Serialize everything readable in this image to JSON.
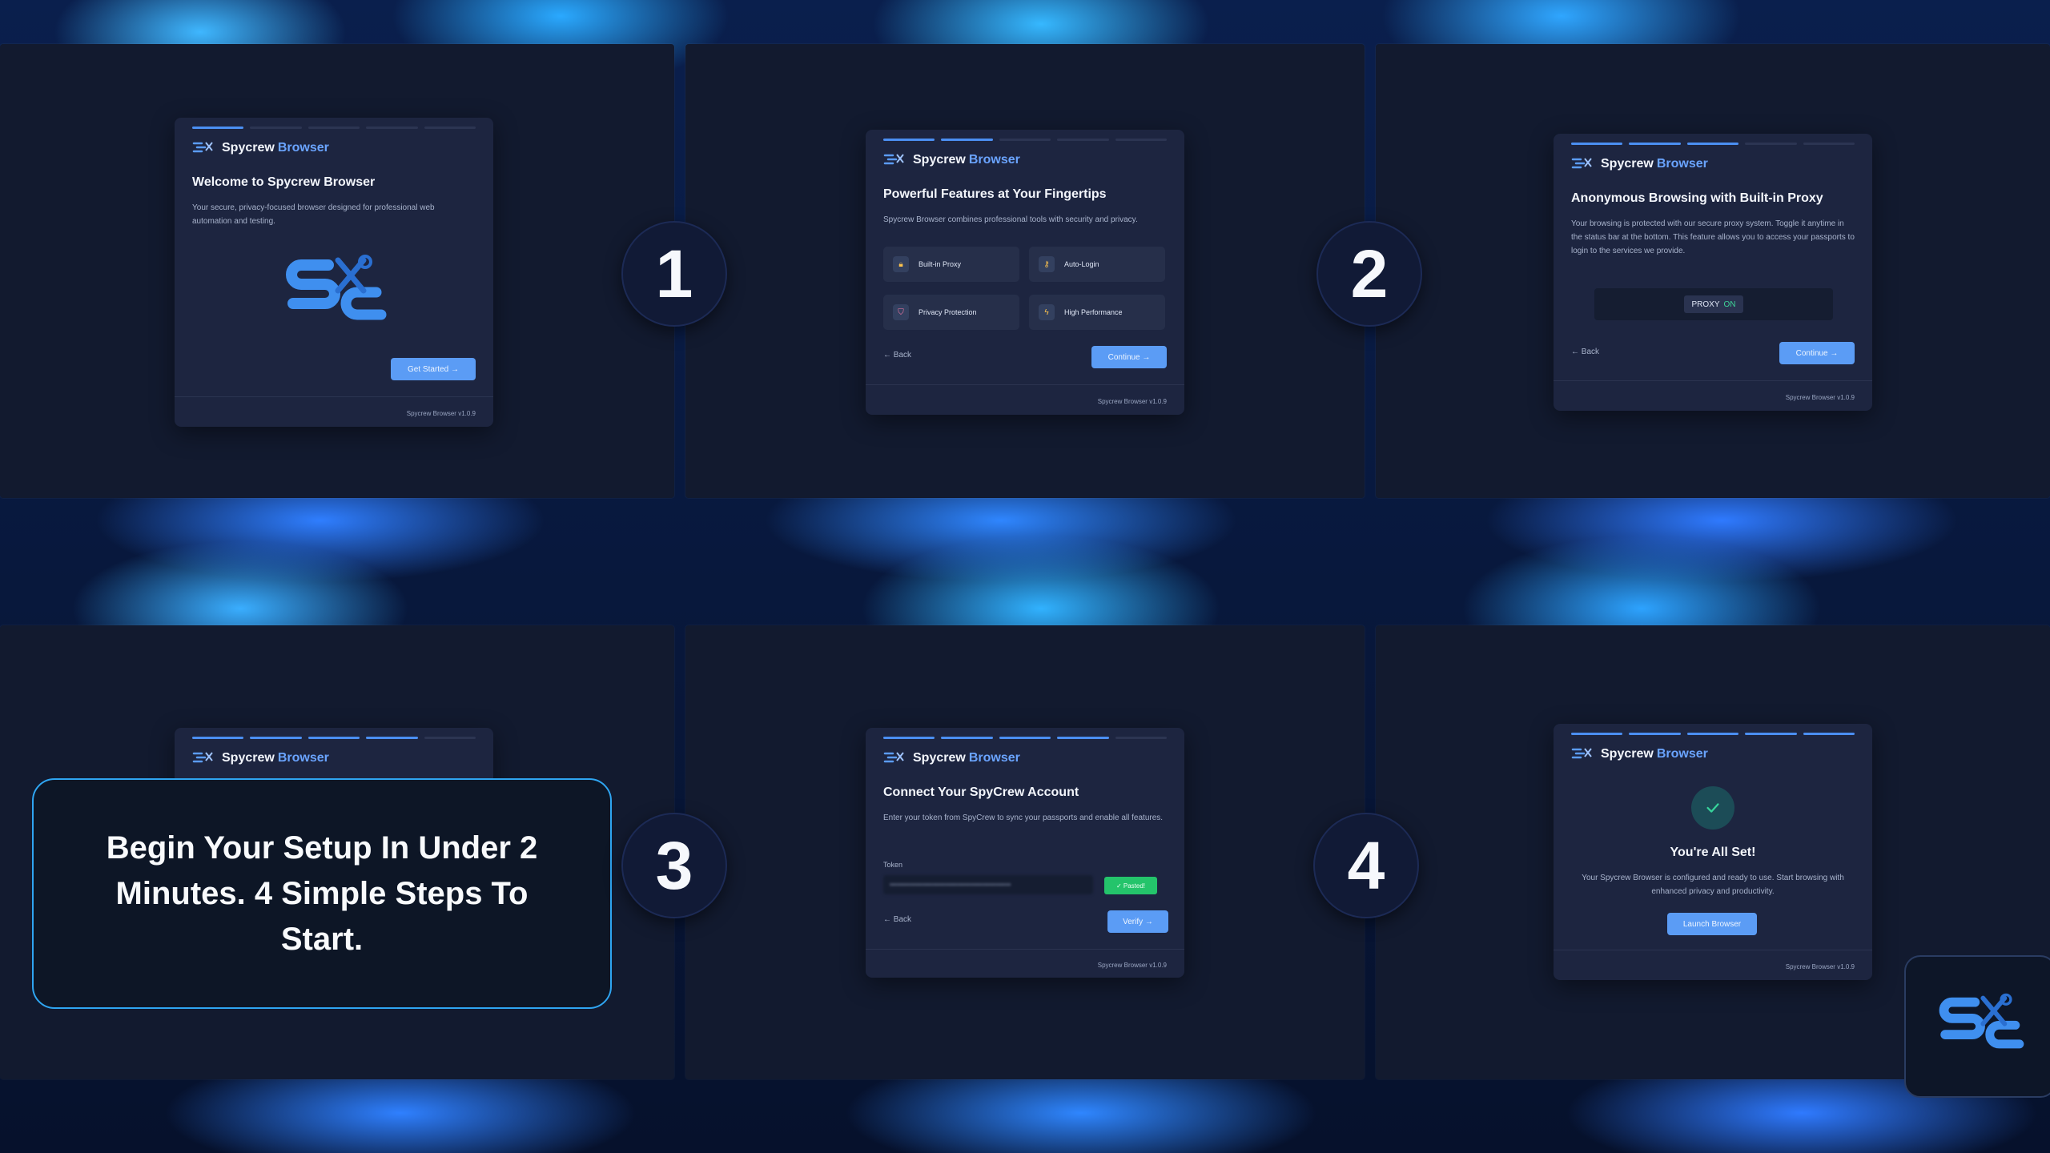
{
  "app": {
    "name_primary": "Spycrew",
    "name_accent": "Browser",
    "version": "Spycrew Browser v1.0.9"
  },
  "promo": {
    "text": "Begin Your Setup In Under 2 Minutes. 4 Simple Steps To Start."
  },
  "step_numbers": [
    "1",
    "2",
    "3",
    "4"
  ],
  "screens": {
    "welcome": {
      "title": "Welcome to Spycrew Browser",
      "text": "Your secure, privacy-focused browser designed for professional web automation and testing.",
      "button": "Get Started →"
    },
    "features": {
      "title": "Powerful Features at Your Fingertips",
      "text": "Spycrew Browser combines professional tools with security and privacy.",
      "items": [
        {
          "label": "Built-in Proxy",
          "icon": "lock-icon"
        },
        {
          "label": "Auto-Login",
          "icon": "key-icon"
        },
        {
          "label": "Privacy Protection",
          "icon": "shield-icon"
        },
        {
          "label": "High Performance",
          "icon": "lightning-icon"
        }
      ],
      "back": "← Back",
      "button": "Continue →"
    },
    "proxy": {
      "title": "Anonymous Browsing with Built-in Proxy",
      "text": "Your browsing is protected with our secure proxy system. Toggle it anytime in the status bar at the bottom. This feature allows you to access your passports to login to the services we provide.",
      "proxy_label": "PROXY",
      "proxy_state": "ON",
      "back": "← Back",
      "button": "Continue →"
    },
    "account": {
      "title": "Connect Your SpyCrew Account",
      "text": "Enter your token from SpyCrew to sync your passports and enable all features.",
      "token_label": "Token",
      "token_value": "••••••••••••••••••••••••••••••••••••••••••••••••",
      "pasted": "✓ Pasted!",
      "back": "← Back",
      "button": "Verify →"
    },
    "done": {
      "title": "You're All Set!",
      "text": "Your Spycrew Browser is configured and ready to use. Start browsing with enhanced privacy and productivity.",
      "button": "Launch Browser"
    }
  }
}
